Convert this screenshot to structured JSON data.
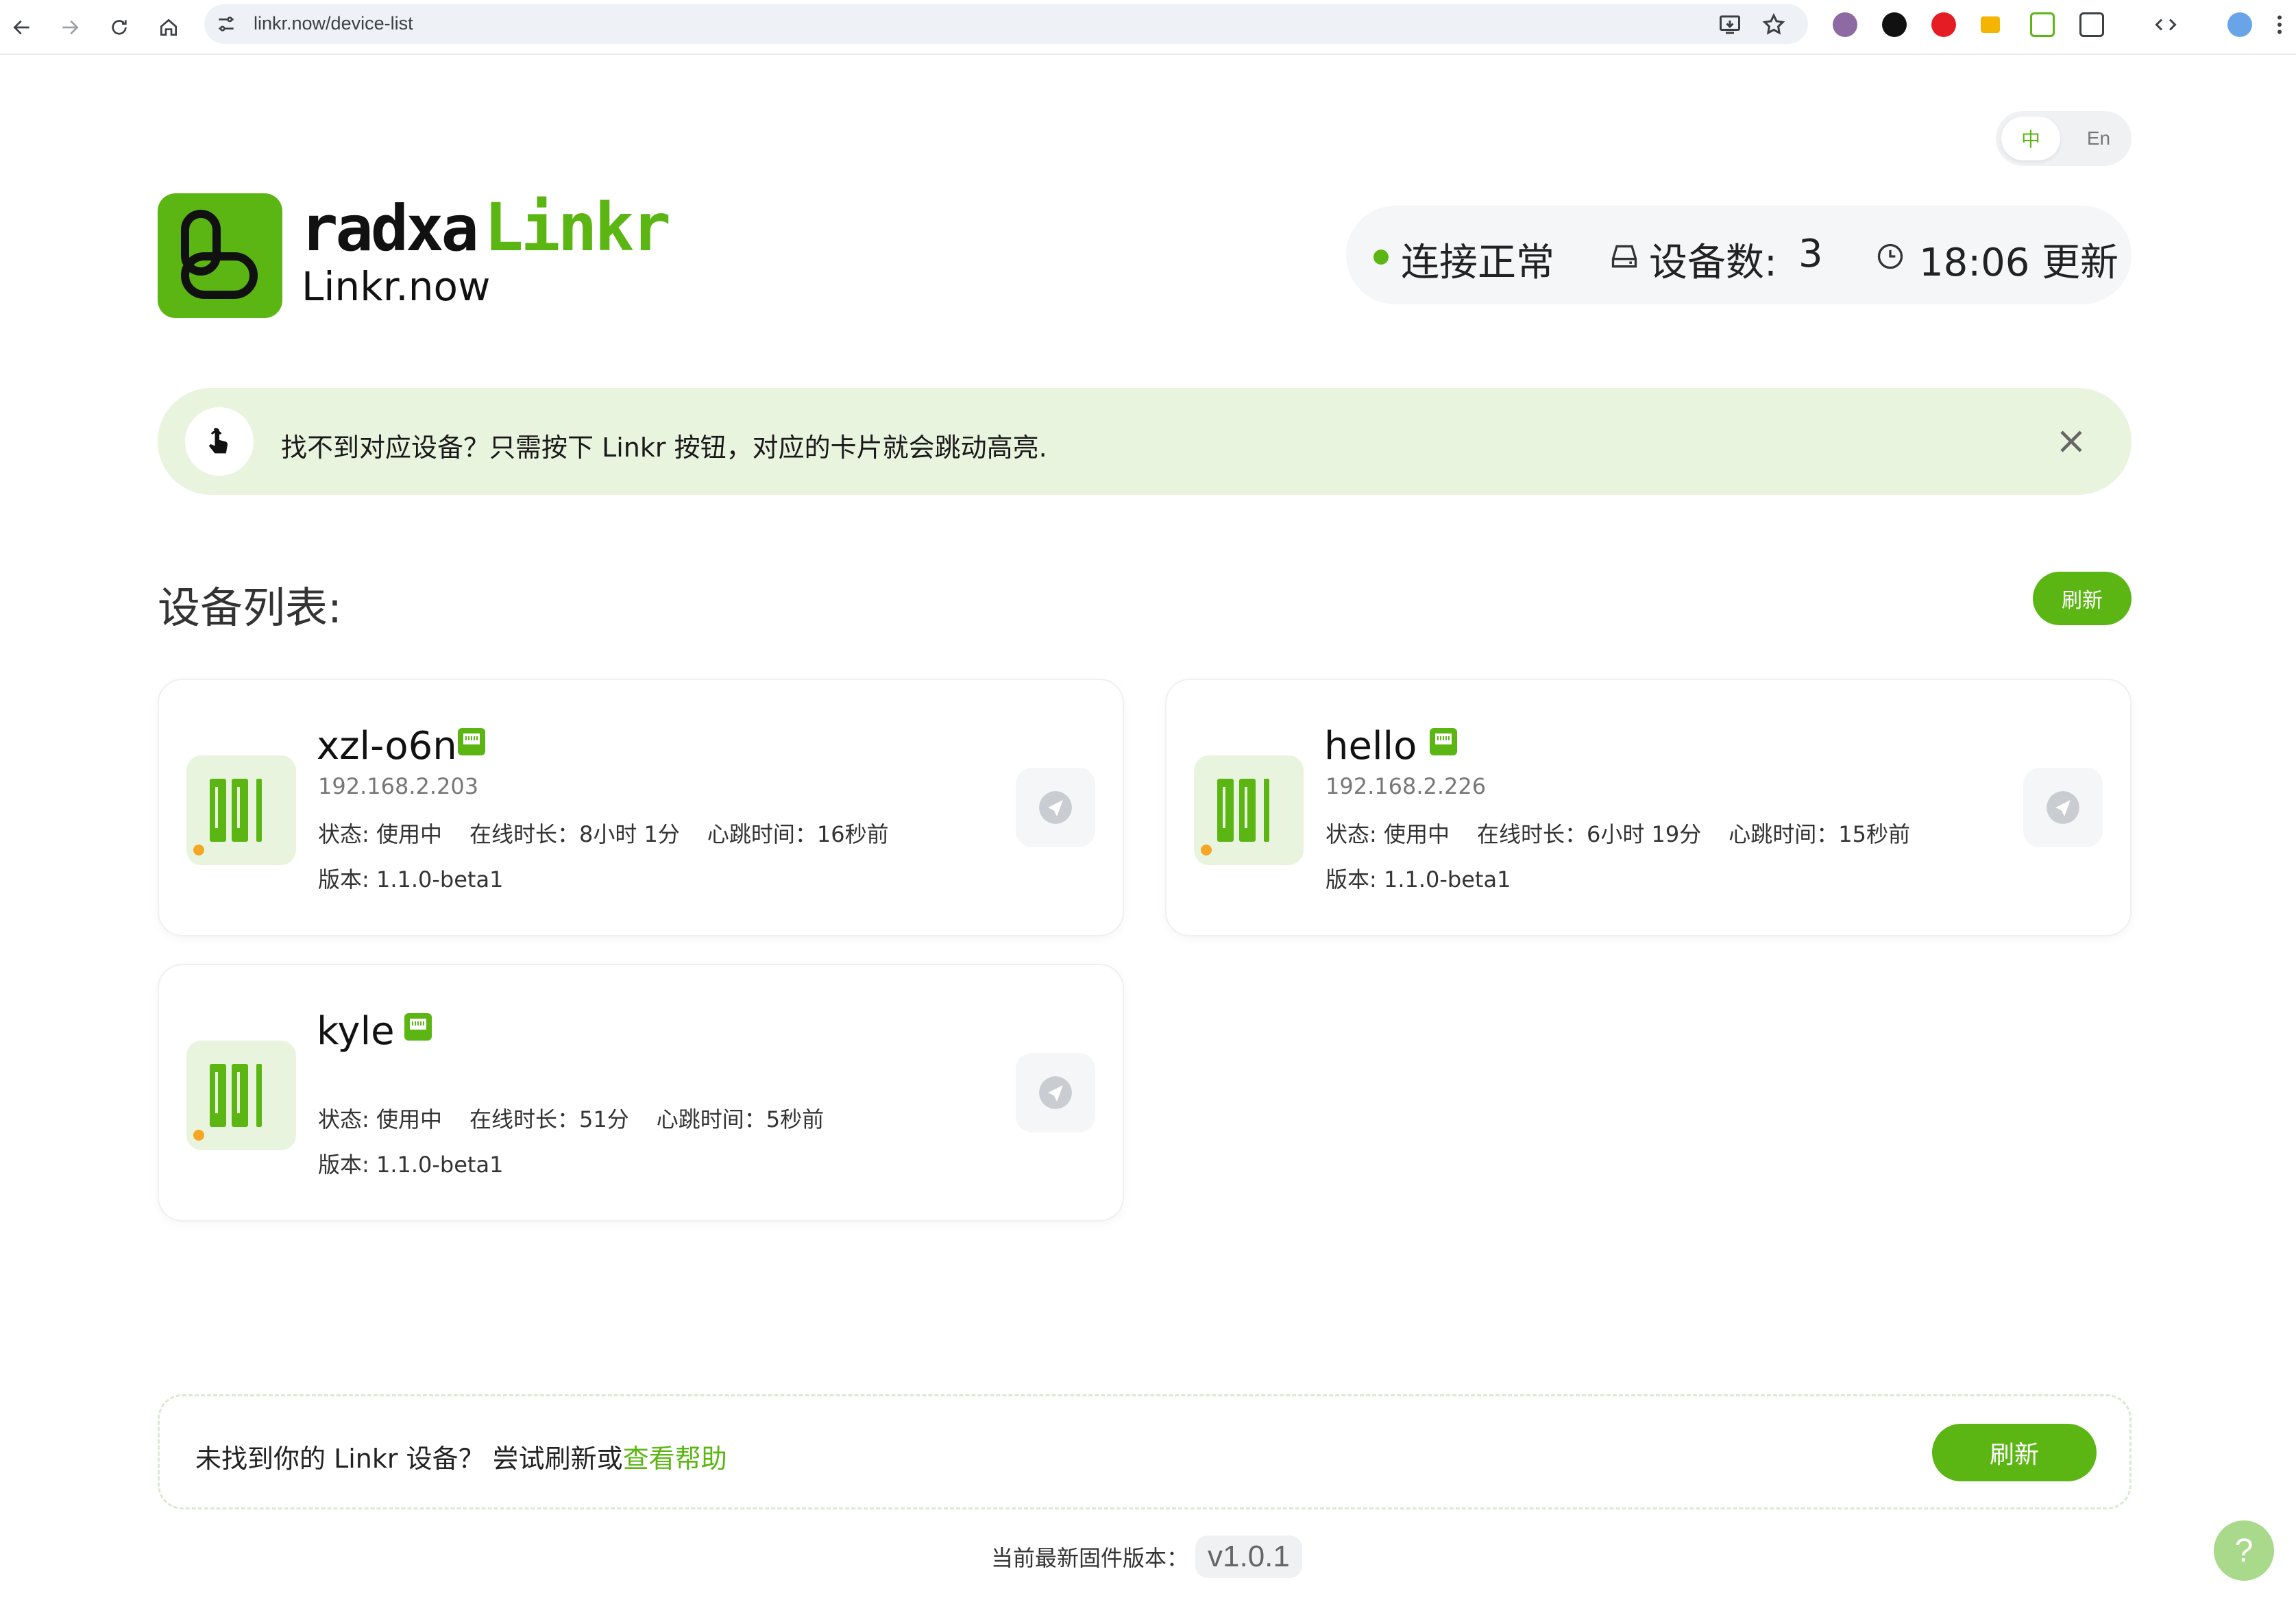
{
  "browser": {
    "url": "linkr.now/device-list"
  },
  "lang": {
    "zh": "中",
    "en": "En"
  },
  "brand": {
    "radxa": "radxa",
    "linkr": "Linkr",
    "domain": "Linkr.now"
  },
  "status": {
    "connection": "连接正常",
    "device_count_label": "设备数:",
    "device_count": "3",
    "updated": "18:06 更新"
  },
  "tip": {
    "text": "找不到对应设备？只需按下 Linkr 按钮，对应的卡片就会跳动高亮."
  },
  "section": {
    "title": "设备列表:",
    "refresh": "刷新"
  },
  "devices": [
    {
      "name": "xzl-o6n",
      "ip": "192.168.2.203",
      "state": "状态: 使用中",
      "online": "在线时长：8小时 1分",
      "heartbeat": "心跳时间：16秒前",
      "version": "版本: 1.1.0-beta1"
    },
    {
      "name": "hello",
      "ip": "192.168.2.226",
      "state": "状态: 使用中",
      "online": "在线时长：6小时 19分",
      "heartbeat": "心跳时间：15秒前",
      "version": "版本: 1.1.0-beta1"
    },
    {
      "name": "kyle",
      "ip": "",
      "state": "状态: 使用中",
      "online": "在线时长：51分",
      "heartbeat": "心跳时间：5秒前",
      "version": "版本: 1.1.0-beta1"
    }
  ],
  "help": {
    "text": "未找到你的 Linkr 设备？ 尝试刷新或",
    "link": "查看帮助",
    "refresh": "刷新"
  },
  "firmware": {
    "label": "当前最新固件版本：",
    "version": "v1.0.1"
  },
  "fab": {
    "label": "?"
  },
  "colors": {
    "accent": "#5bb614",
    "accent_light": "#e9f4df",
    "warning_dot": "#f5a623"
  }
}
